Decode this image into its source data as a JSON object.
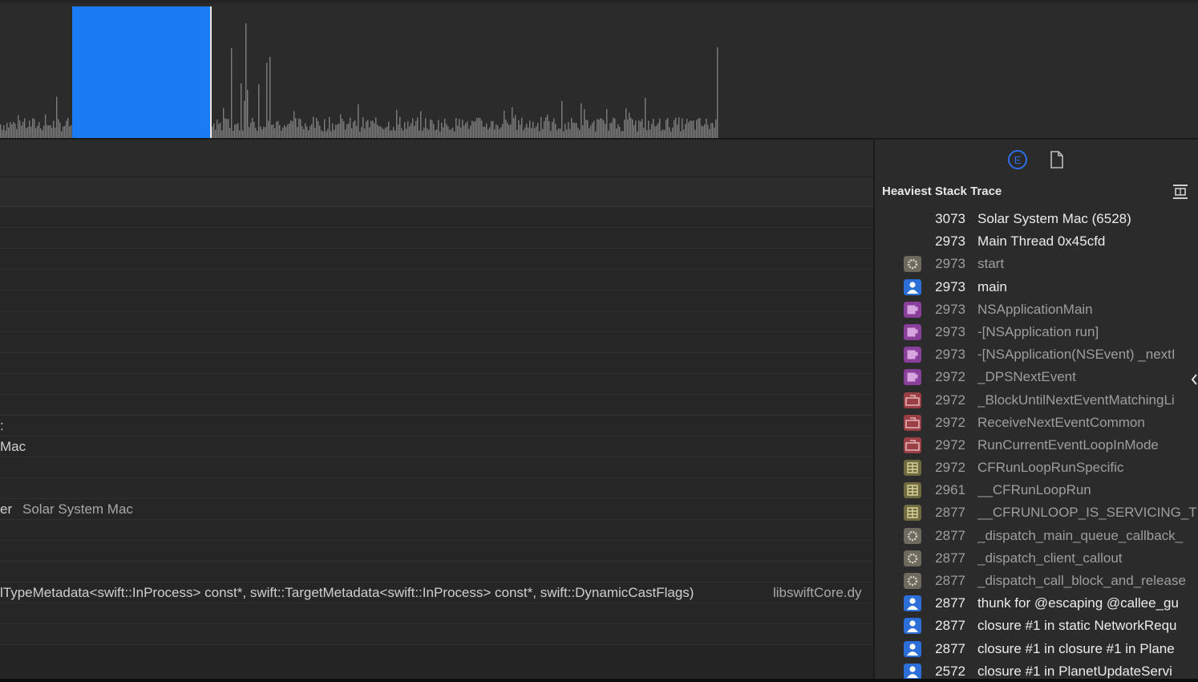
{
  "timeline": {
    "selection_color": "#1a7cf5",
    "bar_color": "#7d7d7d"
  },
  "rows": [
    {
      "text": ""
    },
    {
      "text": ""
    },
    {
      "text": ""
    },
    {
      "text": ""
    },
    {
      "text": ""
    },
    {
      "text": ""
    },
    {
      "text": ""
    },
    {
      "text": ""
    },
    {
      "text": ""
    },
    {
      "text": ""
    },
    {
      "text": ":"
    },
    {
      "text": "Mac"
    },
    {
      "text": ""
    },
    {
      "text": ""
    },
    {
      "text": "er",
      "extra": "Solar System Mac"
    },
    {
      "text": ""
    },
    {
      "text": ""
    },
    {
      "text": ""
    },
    {
      "text": "lTypeMetadata<swift::InProcess> const*, swift::TargetMetadata<swift::InProcess> const*, swift::DynamicCastFlags)",
      "lib": "libswiftCore.dy"
    },
    {
      "text": ""
    },
    {
      "text": ""
    }
  ],
  "inspector": {
    "title": "Heaviest Stack Trace",
    "tabs": [
      {
        "name": "extended-detail-tab",
        "icon": "circled-e-icon",
        "active": true
      },
      {
        "name": "file-tab",
        "icon": "document-icon",
        "active": false
      }
    ]
  },
  "stack": [
    {
      "count": "3073",
      "symbol": "Solar System Mac (6528)",
      "icon": "none",
      "style": "bright"
    },
    {
      "count": "2973",
      "symbol": "Main Thread  0x45cfd",
      "icon": "none",
      "style": "bright"
    },
    {
      "count": "2973",
      "symbol": "start",
      "icon": "gear-icon",
      "style": "dim"
    },
    {
      "count": "2973",
      "symbol": "main",
      "icon": "user-icon",
      "style": "bright"
    },
    {
      "count": "2973",
      "symbol": "NSApplicationMain",
      "icon": "cup-icon",
      "style": "dim"
    },
    {
      "count": "2973",
      "symbol": "-[NSApplication run]",
      "icon": "cup-icon",
      "style": "dim"
    },
    {
      "count": "2973",
      "symbol": "-[NSApplication(NSEvent) _nextI",
      "icon": "cup-icon",
      "style": "dim"
    },
    {
      "count": "2972",
      "symbol": "_DPSNextEvent",
      "icon": "cup-icon",
      "style": "dim"
    },
    {
      "count": "2972",
      "symbol": "_BlockUntilNextEventMatchingLi",
      "icon": "toolbox-icon",
      "style": "dim"
    },
    {
      "count": "2972",
      "symbol": "ReceiveNextEventCommon",
      "icon": "toolbox-icon",
      "style": "dim"
    },
    {
      "count": "2972",
      "symbol": "RunCurrentEventLoopInMode",
      "icon": "toolbox-icon",
      "style": "dim"
    },
    {
      "count": "2972",
      "symbol": "CFRunLoopRunSpecific",
      "icon": "grid-icon",
      "style": "dim"
    },
    {
      "count": "2961",
      "symbol": "__CFRunLoopRun",
      "icon": "grid-icon",
      "style": "dim"
    },
    {
      "count": "2877",
      "symbol": "__CFRUNLOOP_IS_SERVICING_TH",
      "icon": "grid-icon",
      "style": "dim"
    },
    {
      "count": "2877",
      "symbol": "_dispatch_main_queue_callback_",
      "icon": "gear-icon",
      "style": "dim"
    },
    {
      "count": "2877",
      "symbol": "_dispatch_client_callout",
      "icon": "gear-icon",
      "style": "dim"
    },
    {
      "count": "2877",
      "symbol": "_dispatch_call_block_and_release",
      "icon": "gear-icon",
      "style": "dim"
    },
    {
      "count": "2877",
      "symbol": "thunk for @escaping @callee_gu",
      "icon": "user-icon",
      "style": "bright"
    },
    {
      "count": "2877",
      "symbol": "closure #1 in static NetworkRequ",
      "icon": "user-icon",
      "style": "bright"
    },
    {
      "count": "2877",
      "symbol": "closure #1 in closure #1 in Plane",
      "icon": "user-icon",
      "style": "bright"
    },
    {
      "count": "2572",
      "symbol": "closure #1 in PlanetUpdateServi",
      "icon": "user-icon",
      "style": "bright"
    }
  ],
  "icon_colors": {
    "gear-icon": "#6f6a5f",
    "user-icon": "#2c6fd8",
    "cup-icon": "#8a3f9a",
    "toolbox-icon": "#9a3f44",
    "grid-icon": "#6f6a3f"
  }
}
